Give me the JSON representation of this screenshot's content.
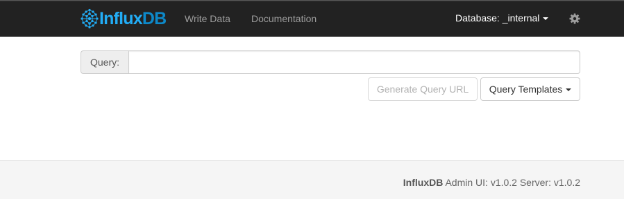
{
  "navbar": {
    "brand": {
      "text_a": "Influx",
      "text_b": "DB"
    },
    "links": [
      {
        "label": "Write Data"
      },
      {
        "label": "Documentation"
      }
    ],
    "database_dropdown": {
      "label": "Database: _internal"
    },
    "settings_icon": "gear-icon"
  },
  "query": {
    "addon_label": "Query:",
    "input_value": "",
    "input_placeholder": ""
  },
  "buttons": {
    "generate_url": {
      "label": "Generate Query URL",
      "disabled": true
    },
    "templates": {
      "label": "Query Templates"
    }
  },
  "footer": {
    "product": "InfluxDB",
    "version_text": "Admin UI: v1.0.2 Server: v1.0.2"
  },
  "colors": {
    "navbar_bg": "#222222",
    "brand_light": "#22adf6",
    "brand_dark": "#0d89c9",
    "nav_link": "#9d9d9d",
    "footer_bg": "#f5f5f5"
  }
}
